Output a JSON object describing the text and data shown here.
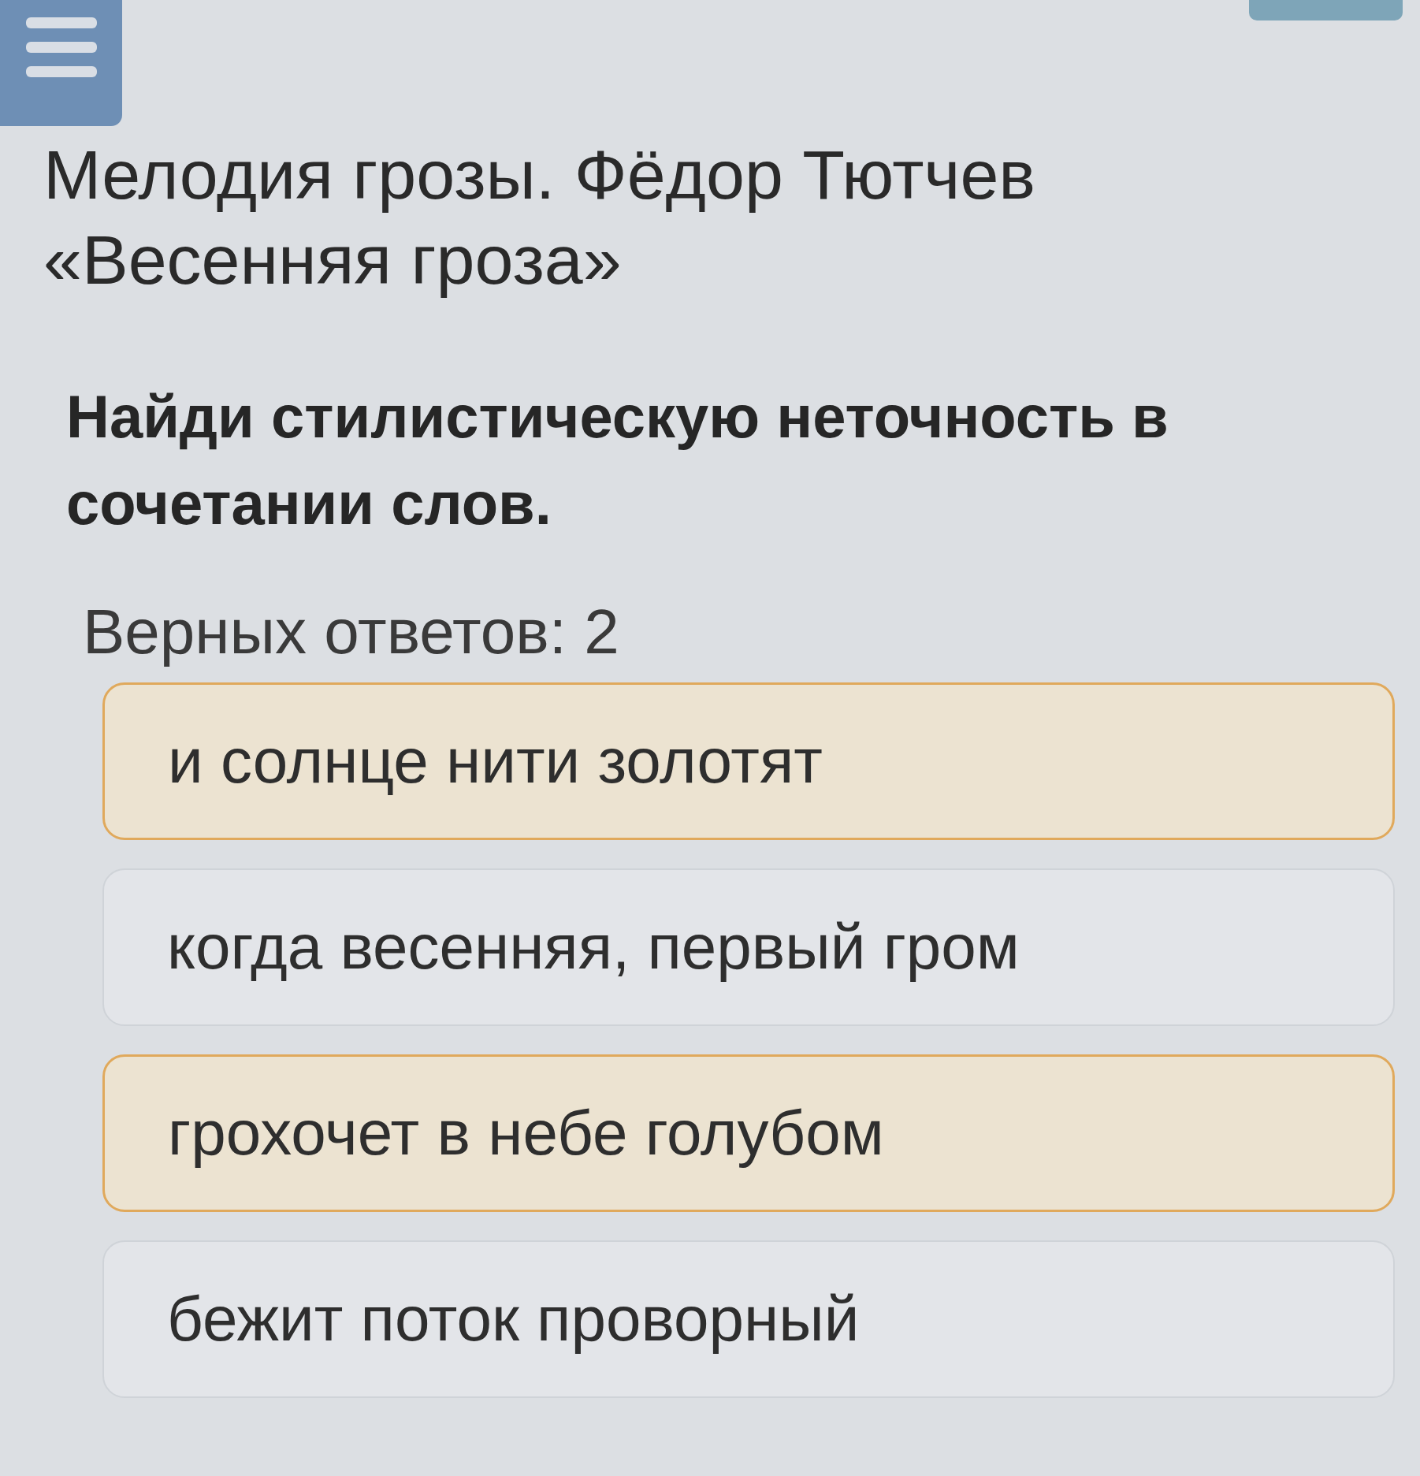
{
  "lesson_title": "Мелодия грозы. Фёдор Тютчев «Весенняя гроза»",
  "question": "Найди стилистическую неточность в сочетании слов.",
  "correct_count": "Верных ответов: 2",
  "options": [
    {
      "text": "и солнце нити золотят",
      "selected": true
    },
    {
      "text": "когда весенняя, первый гром",
      "selected": false
    },
    {
      "text": "грохочет в небе голубом",
      "selected": true
    },
    {
      "text": "бежит поток проворный",
      "selected": false
    }
  ]
}
